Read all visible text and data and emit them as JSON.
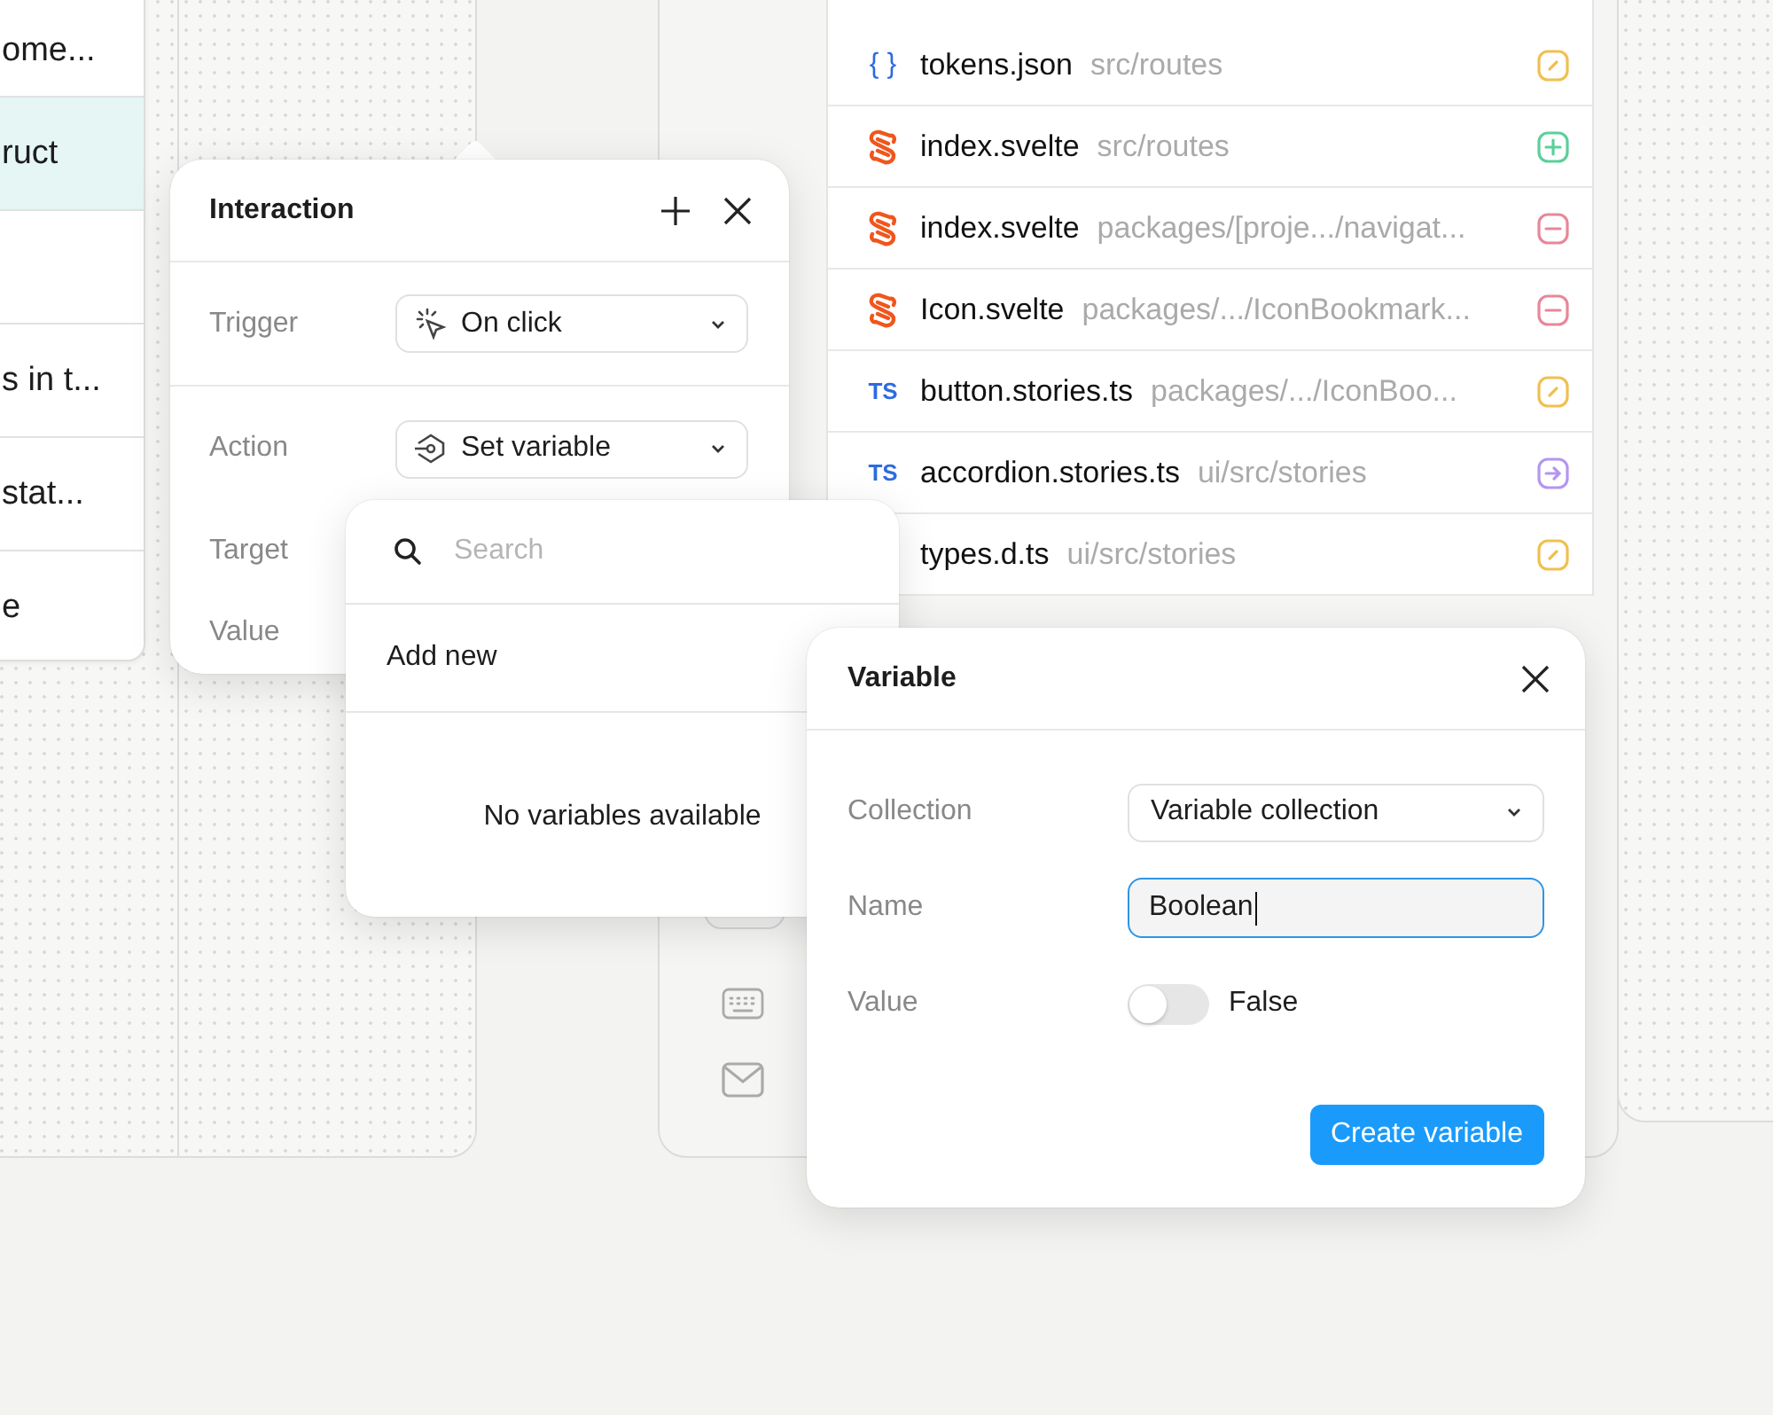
{
  "list_card": {
    "rows": [
      {
        "label": "ome...",
        "selected": false
      },
      {
        "label": "ruct",
        "selected": true
      },
      {
        "label": "",
        "selected": false
      },
      {
        "label": "s in t...",
        "selected": false
      },
      {
        "label": "stat...",
        "selected": false
      },
      {
        "label": "e",
        "selected": false
      }
    ]
  },
  "files": [
    {
      "kind": "json",
      "icon_text": "{ }",
      "name": "tokens.json",
      "path": "src/routes",
      "status": {
        "kind": "modified",
        "color": "#f0c050"
      }
    },
    {
      "kind": "svelte",
      "name": "index.svelte",
      "path": "src/routes",
      "status": {
        "kind": "added",
        "color": "#5ccf9a"
      }
    },
    {
      "kind": "svelte",
      "name": "index.svelte",
      "path": "packages/[proje.../navigat...",
      "status": {
        "kind": "removed",
        "color": "#e8879a"
      }
    },
    {
      "kind": "svelte",
      "name": "Icon.svelte",
      "path": "packages/.../IconBookmark...",
      "status": {
        "kind": "removed",
        "color": "#e8879a"
      }
    },
    {
      "kind": "ts",
      "icon_text": "TS",
      "name": "button.stories.ts",
      "path": "packages/.../IconBoo...",
      "status": {
        "kind": "modified",
        "color": "#f0c050"
      }
    },
    {
      "kind": "ts",
      "icon_text": "TS",
      "name": "accordion.stories.ts",
      "path": "ui/src/stories",
      "status": {
        "kind": "renamed",
        "color": "#b496f0"
      }
    },
    {
      "kind": "none",
      "name": "types.d.ts",
      "path": "ui/src/stories",
      "status": {
        "kind": "modified",
        "color": "#f0c050"
      }
    }
  ],
  "interaction": {
    "title": "Interaction",
    "rows": [
      {
        "label": "Trigger",
        "kind": "select",
        "value": "On click"
      },
      {
        "label": "Action",
        "kind": "select",
        "value": "Set variable"
      },
      {
        "label": "Target",
        "kind": "plain"
      },
      {
        "label": "Value",
        "kind": "plain"
      }
    ]
  },
  "variable_picker": {
    "search": {
      "placeholder": "Search"
    },
    "add_new": "Add new",
    "empty": "No variables available"
  },
  "variable_dialog": {
    "title": "Variable",
    "collection": {
      "label": "Collection",
      "value": "Variable collection"
    },
    "name": {
      "label": "Name",
      "value": "Boolean"
    },
    "value": {
      "label": "Value",
      "on": false,
      "text": "False"
    },
    "button": "Create variable"
  }
}
